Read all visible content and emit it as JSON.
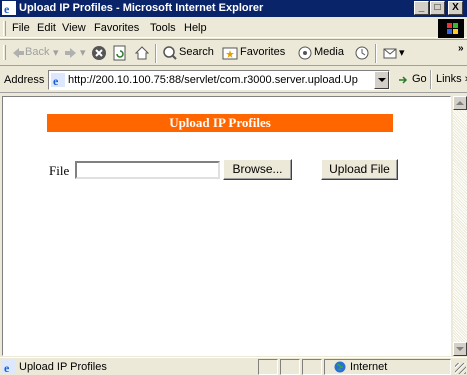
{
  "window": {
    "title": "Upload IP Profiles - Microsoft Internet Explorer",
    "controls": {
      "minimize": "_",
      "maximize": "□",
      "close": "X"
    }
  },
  "menu": {
    "items": [
      "File",
      "Edit",
      "View",
      "Favorites",
      "Tools",
      "Help"
    ]
  },
  "toolbar": {
    "back_label": "Back",
    "search_label": "Search",
    "favorites_label": "Favorites",
    "media_label": "Media",
    "more": "»"
  },
  "address": {
    "label": "Address",
    "url": "http://200.10.100.75:88/servlet/com.r3000.server.upload.Up",
    "go_label": "Go",
    "links_label": "Links »"
  },
  "page": {
    "header": "Upload IP Profiles",
    "file_label": "File",
    "file_value": "",
    "browse_label": "Browse...",
    "upload_label": "Upload File",
    "header_color": "#ff6600"
  },
  "status": {
    "text": "Upload IP Profiles",
    "zone": "Internet"
  },
  "icons": {
    "title": "ie-icon",
    "address": "ie-page-icon",
    "status": "ie-page-icon",
    "zone": "globe-icon"
  }
}
